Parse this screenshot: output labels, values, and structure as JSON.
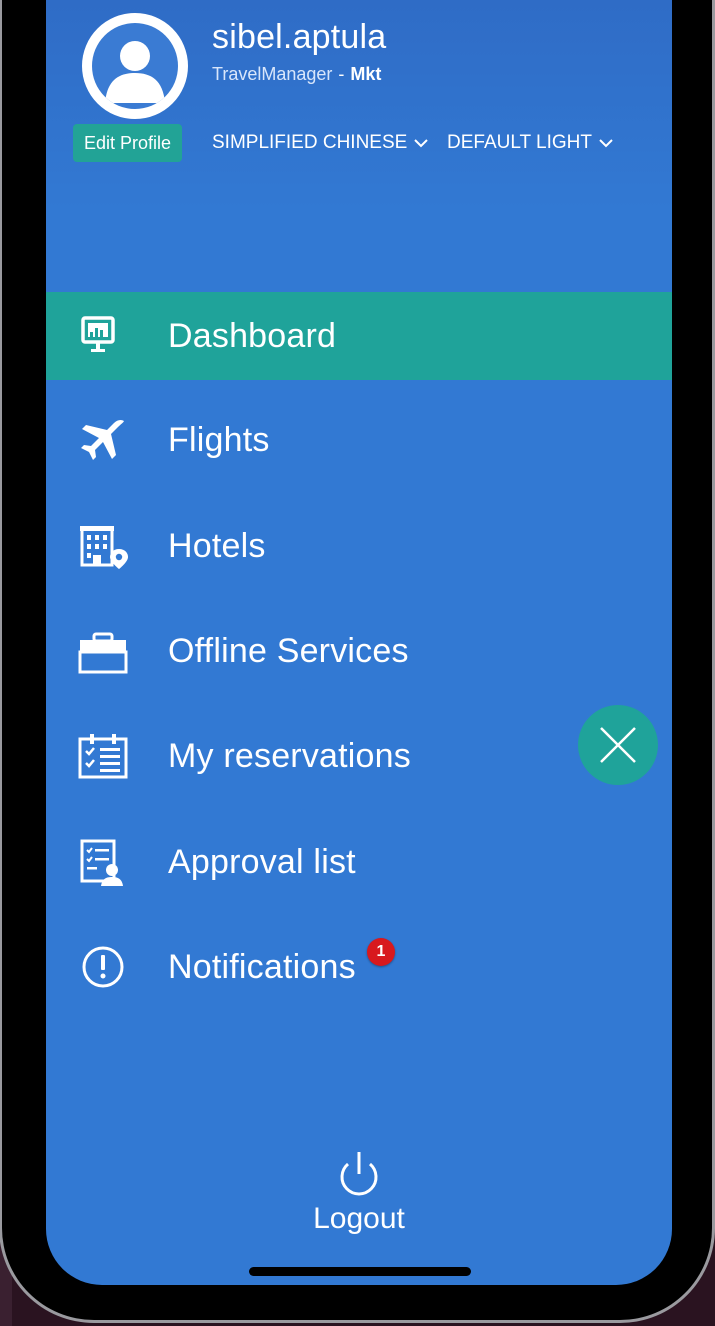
{
  "profile": {
    "username": "sibel.aptula",
    "role": "TravelManager",
    "separator": "-",
    "department": "Mkt",
    "edit_label": "Edit Profile",
    "language": "SIMPLIFIED CHINESE",
    "theme": "DEFAULT LIGHT"
  },
  "menu": {
    "dashboard": "Dashboard",
    "flights": "Flights",
    "hotels": "Hotels",
    "offline_services": "Offline Services",
    "my_reservations": "My reservations",
    "approval_list": "Approval list",
    "notifications": "Notifications",
    "notifications_count": "1",
    "active_item": "Dashboard"
  },
  "footer": {
    "logout": "Logout"
  },
  "icons": {
    "avatar": "user-avatar-icon",
    "dashboard": "presentation-board-icon",
    "flights": "airplane-icon",
    "hotels": "hotel-location-icon",
    "offline_services": "briefcase-icon",
    "my_reservations": "calendar-checklist-icon",
    "approval_list": "document-person-icon",
    "notifications": "alert-circle-icon",
    "close": "close-icon",
    "logout": "power-icon"
  },
  "colors": {
    "drawer_bg": "#3279d3",
    "active_bg": "#1fa39a",
    "badge": "#d8191e",
    "text": "#ffffff"
  }
}
